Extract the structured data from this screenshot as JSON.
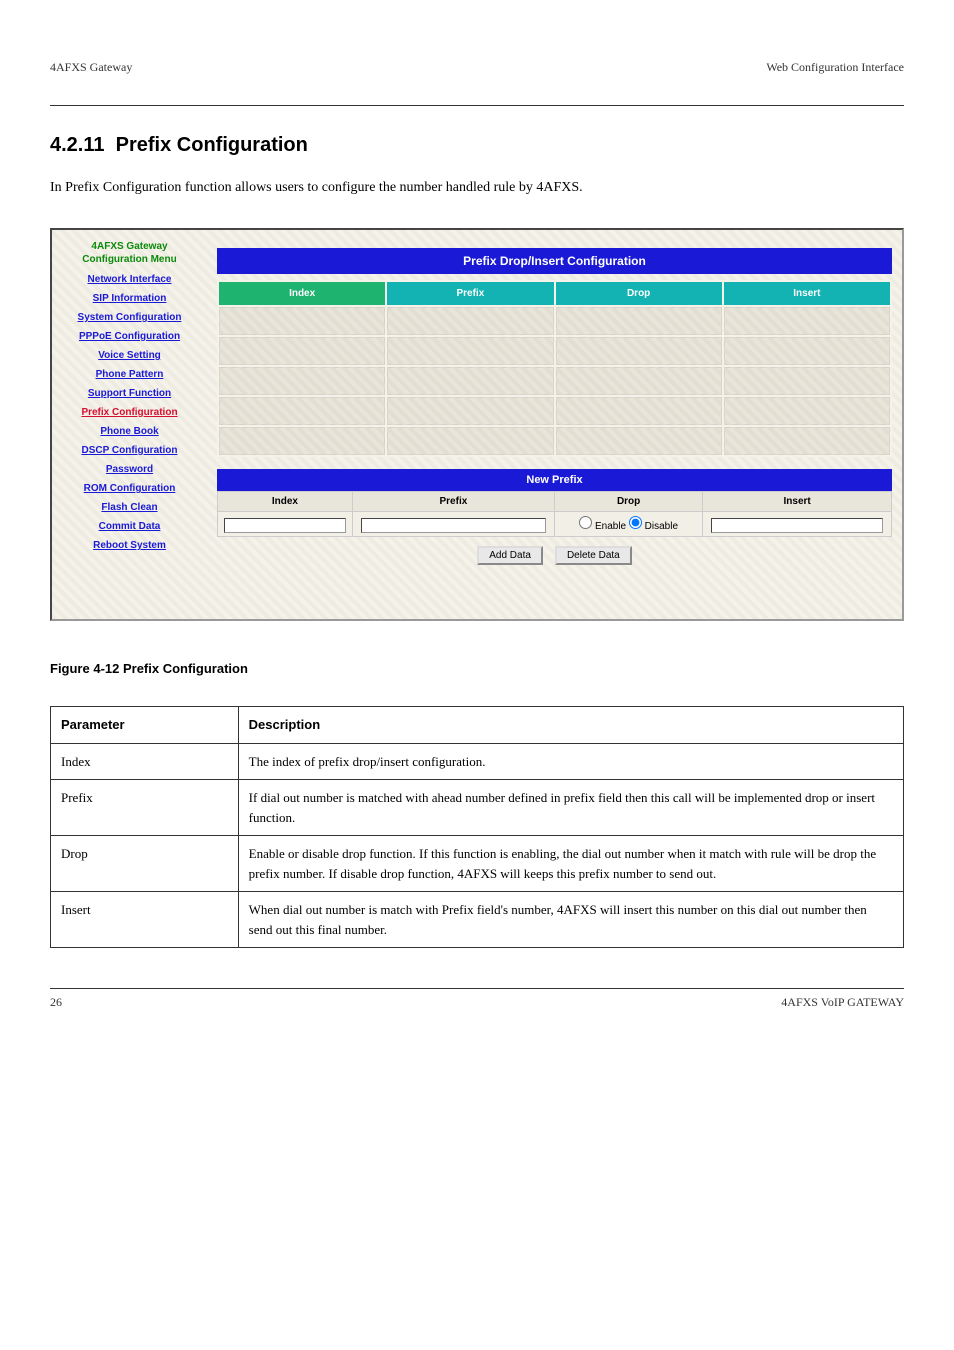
{
  "header": {
    "left": "4AFXS Gateway",
    "right": "Web Configuration Interface"
  },
  "section": {
    "number": "4.2.11",
    "title": "Prefix Configuration"
  },
  "intro": "In Prefix Configuration function allows users to configure the number handled rule by 4AFXS.",
  "screenshot": {
    "sidebar_title1": "4AFXS Gateway",
    "sidebar_title2": "Configuration Menu",
    "menu": [
      "Network Interface",
      "SIP Information",
      "System Configuration",
      "PPPoE Configuration",
      "Voice Setting",
      "Phone Pattern",
      "Support Function",
      "Prefix Configuration",
      "Phone Book",
      "DSCP Configuration",
      "Password",
      "ROM Configuration",
      "Flash Clean",
      "Commit Data",
      "Reboot System"
    ],
    "active_index": 7,
    "title_bar": "Prefix Drop/Insert Configuration",
    "cols": [
      "Index",
      "Prefix",
      "Drop",
      "Insert"
    ],
    "sub_bar": "New Prefix",
    "form_cols": [
      "Index",
      "Prefix",
      "Drop",
      "Insert"
    ],
    "radio_enable": "Enable",
    "radio_disable": "Disable",
    "btn_add": "Add Data",
    "btn_delete": "Delete Data"
  },
  "figure_caption": "Figure 4-12 Prefix Configuration",
  "param_table": {
    "h1": "Parameter",
    "h2": "Description",
    "rows": [
      {
        "p": "Index",
        "d": "The index of prefix drop/insert configuration."
      },
      {
        "p": "Prefix",
        "d": "If dial out number is matched with ahead number defined in prefix field then this call will be implemented drop or insert function."
      },
      {
        "p": "Drop",
        "d": "Enable or disable drop function. If this function is enabling, the dial out number when it match with rule will be drop the prefix number. If disable drop function, 4AFXS will keeps this prefix number to send out."
      },
      {
        "p": "Insert",
        "d": "When dial out number is match with Prefix field's number, 4AFXS will insert this number on this dial out number then send out this final number."
      }
    ]
  },
  "footer": {
    "left": "26",
    "right": "4AFXS VoIP GATEWAY"
  }
}
